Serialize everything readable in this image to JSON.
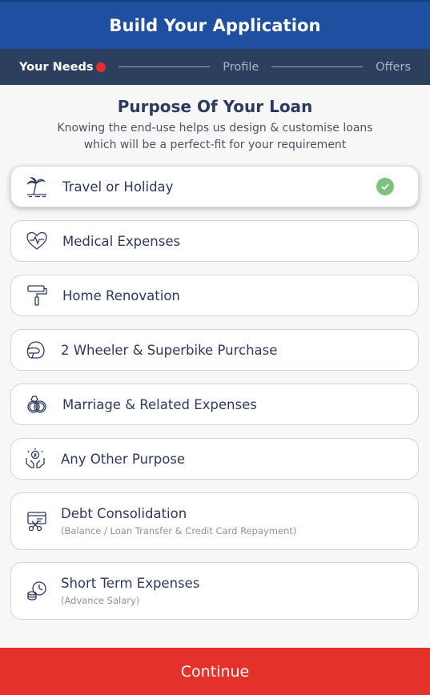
{
  "header": {
    "title": "Build Your Application"
  },
  "stepper": {
    "steps": [
      {
        "label": "Your Needs",
        "active": true
      },
      {
        "label": "Profile",
        "active": false
      },
      {
        "label": "Offers",
        "active": false
      }
    ]
  },
  "main": {
    "heading": "Purpose Of Your Loan",
    "subtitle": "Knowing the end-use helps us design & customise loans which will be a perfect-fit for your requirement",
    "options": [
      {
        "label": "Travel or Holiday",
        "sub": "",
        "icon": "beach-icon",
        "selected": true
      },
      {
        "label": "Medical Expenses",
        "sub": "",
        "icon": "heart-pulse-icon",
        "selected": false
      },
      {
        "label": "Home Renovation",
        "sub": "",
        "icon": "paint-roller-icon",
        "selected": false
      },
      {
        "label": "2 Wheeler & Superbike Purchase",
        "sub": "",
        "icon": "helmet-icon",
        "selected": false
      },
      {
        "label": "Marriage & Related Expenses",
        "sub": "",
        "icon": "rings-icon",
        "selected": false
      },
      {
        "label": "Any Other Purpose",
        "sub": "",
        "icon": "hands-coin-icon",
        "selected": false
      },
      {
        "label": "Debt Consolidation",
        "sub": "(Balance / Loan Transfer & Credit Card Repayment)",
        "icon": "credit-card-cut-icon",
        "selected": false
      },
      {
        "label": "Short Term Expenses",
        "sub": "(Advance Salary)",
        "icon": "coins-clock-icon",
        "selected": false
      }
    ]
  },
  "footer": {
    "continue_label": "Continue"
  },
  "colors": {
    "brand_blue": "#1f4fa1",
    "stepper_bg": "#2d3f5f",
    "accent_red": "#e5312b",
    "check_green": "#7fbf7f"
  }
}
